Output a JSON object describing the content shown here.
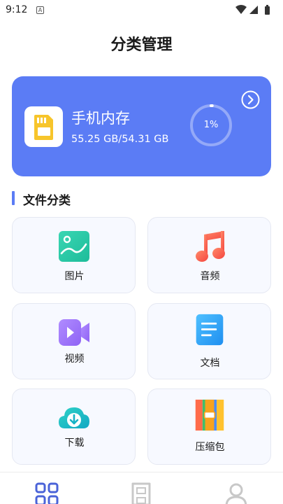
{
  "status_bar": {
    "time": "9:12",
    "notification_badge": "A"
  },
  "page": {
    "title": "分类管理"
  },
  "storage": {
    "name": "手机内存",
    "size_text": "55.25 GB/54.31 GB",
    "usage_text": "1%",
    "usage_fraction": 0.01,
    "card_color": "#5b7cf5"
  },
  "section": {
    "title": "文件分类"
  },
  "categories": [
    {
      "label": "图片",
      "icon": "image-icon"
    },
    {
      "label": "音频",
      "icon": "music-note-icon"
    },
    {
      "label": "视频",
      "icon": "video-camera-icon"
    },
    {
      "label": "文档",
      "icon": "document-icon"
    },
    {
      "label": "下载",
      "icon": "cloud-download-icon"
    },
    {
      "label": "压缩包",
      "icon": "archive-box-icon"
    }
  ],
  "tab_bar": {
    "tabs": [
      {
        "icon": "category-grid-icon",
        "active": true
      },
      {
        "icon": "sd-card-icon",
        "active": false
      },
      {
        "icon": "profile-icon",
        "active": false
      }
    ],
    "active_color": "#4a63d8",
    "inactive_color": "#c8c8c8"
  }
}
